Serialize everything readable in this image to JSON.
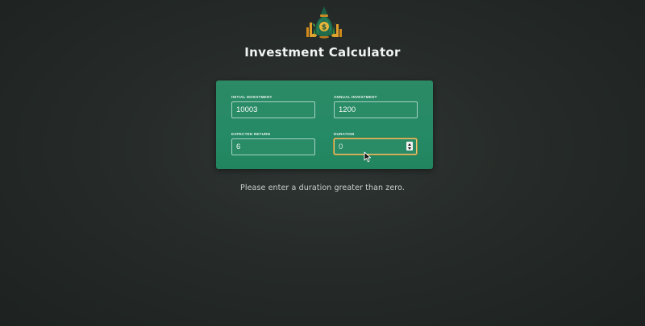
{
  "header": {
    "title": "Investment Calculator",
    "logo_icon": "money-bag-icon"
  },
  "inputs": {
    "initial_investment": {
      "label": "Initial Investment",
      "value": "10003"
    },
    "annual_investment": {
      "label": "Annual Investment",
      "value": "1200"
    },
    "expected_return": {
      "label": "Expected Return",
      "value": "6"
    },
    "duration": {
      "label": "Duration",
      "value": "0",
      "state": "focused"
    }
  },
  "message": "Please enter a duration greater than zero.",
  "colors": {
    "background": "#262b29",
    "panel": "#258a66",
    "focus_border": "#e9c979",
    "title": "#f1f4f2"
  }
}
